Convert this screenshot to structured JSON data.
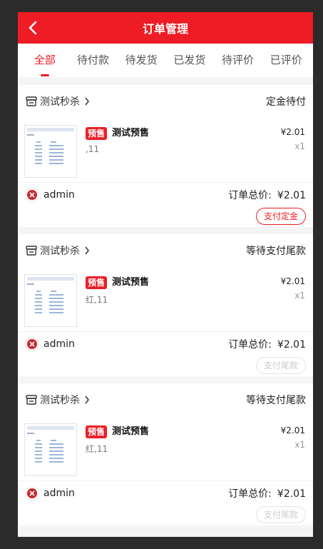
{
  "header": {
    "title": "订单管理"
  },
  "tabs": [
    "全部",
    "待付款",
    "待发货",
    "已发货",
    "待评价",
    "已评价"
  ],
  "orders": [
    {
      "shop_name": "测试秒杀",
      "status": "定金待付",
      "tag": "预售",
      "product_name": "测试预售",
      "spec": ",11",
      "price": "¥2.01",
      "qty": "x1",
      "user": "admin",
      "total_label": "订单总价:",
      "total_value": "¥2.01",
      "button_label": "支付定金",
      "button_enabled": true
    },
    {
      "shop_name": "测试秒杀",
      "status": "等待支付尾款",
      "tag": "预售",
      "product_name": "测试预售",
      "spec": "红,11",
      "price": "¥2.01",
      "qty": "x1",
      "user": "admin",
      "total_label": "订单总价:",
      "total_value": "¥2.01",
      "button_label": "支付尾款",
      "button_enabled": false
    },
    {
      "shop_name": "测试秒杀",
      "status": "等待支付尾款",
      "tag": "预售",
      "product_name": "测试预售",
      "spec": "红,11",
      "price": "¥2.01",
      "qty": "x1",
      "user": "admin",
      "total_label": "订单总价:",
      "total_value": "¥2.01",
      "button_label": "支付尾款",
      "button_enabled": false
    }
  ],
  "colors": {
    "accent": "#ee1c25",
    "background": "#f5f5f5"
  },
  "icons": {
    "back": "chevron-left-icon",
    "store": "store-icon",
    "chevron": "chevron-right-icon"
  }
}
